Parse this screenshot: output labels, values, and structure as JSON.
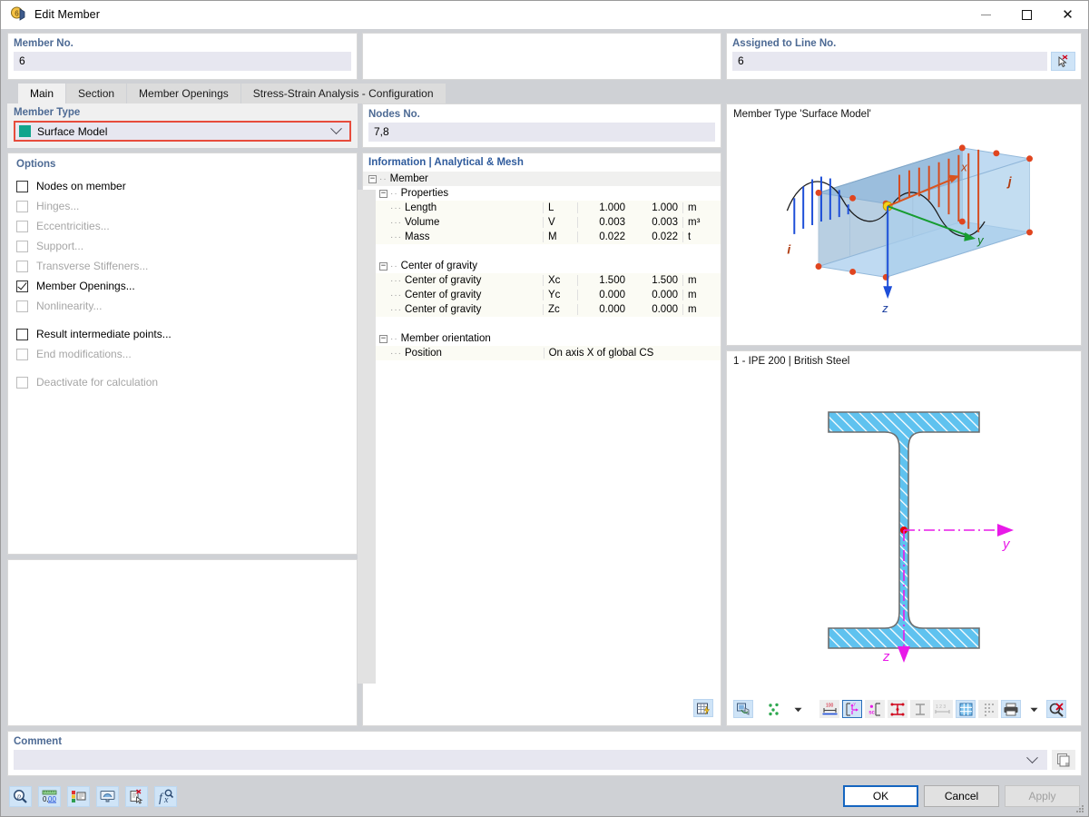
{
  "window": {
    "title": "Edit Member",
    "icon": "member-icon",
    "minimize_label": "Minimize",
    "maximize_label": "Maximize",
    "close_label": "Close"
  },
  "header": {
    "member_no_label": "Member No.",
    "member_no_value": "6",
    "assigned_label": "Assigned to Line No.",
    "assigned_value": "6",
    "pick_icon": "pick-line-icon"
  },
  "tabs": [
    {
      "label": "Main",
      "active": true
    },
    {
      "label": "Section",
      "active": false
    },
    {
      "label": "Member Openings",
      "active": false
    },
    {
      "label": "Stress-Strain Analysis - Configuration",
      "active": false
    }
  ],
  "member_type": {
    "group_label": "Member Type",
    "value": "Surface Model",
    "swatch_color": "#12a58c",
    "highlight_color": "#e74c3c"
  },
  "options": {
    "group_label": "Options",
    "items": [
      {
        "label": "Nodes on member",
        "checked": false,
        "enabled": true,
        "gap_after": false
      },
      {
        "label": "Hinges...",
        "checked": false,
        "enabled": false,
        "gap_after": false
      },
      {
        "label": "Eccentricities...",
        "checked": false,
        "enabled": false,
        "gap_after": false
      },
      {
        "label": "Support...",
        "checked": false,
        "enabled": false,
        "gap_after": false
      },
      {
        "label": "Transverse Stiffeners...",
        "checked": false,
        "enabled": false,
        "gap_after": false
      },
      {
        "label": "Member Openings...",
        "checked": true,
        "enabled": true,
        "gap_after": false
      },
      {
        "label": "Nonlinearity...",
        "checked": false,
        "enabled": false,
        "gap_after": true
      },
      {
        "label": "Result intermediate points...",
        "checked": false,
        "enabled": true,
        "gap_after": false
      },
      {
        "label": "End modifications...",
        "checked": false,
        "enabled": false,
        "gap_after": true
      },
      {
        "label": "Deactivate for calculation",
        "checked": false,
        "enabled": false,
        "gap_after": false
      }
    ]
  },
  "nodes": {
    "group_label": "Nodes No.",
    "value": "7,8"
  },
  "info": {
    "title": "Information | Analytical & Mesh",
    "root": "Member",
    "groups": [
      {
        "name": "Properties",
        "rows": [
          {
            "name": "Length",
            "symbol": "L",
            "v1": "1.000",
            "v2": "1.000",
            "unit": "m"
          },
          {
            "name": "Volume",
            "symbol": "V",
            "v1": "0.003",
            "v2": "0.003",
            "unit": "m³"
          },
          {
            "name": "Mass",
            "symbol": "M",
            "v1": "0.022",
            "v2": "0.022",
            "unit": "t"
          }
        ]
      },
      {
        "name": "Center of gravity",
        "rows": [
          {
            "name": "Center of gravity",
            "symbol": "Xc",
            "v1": "1.500",
            "v2": "1.500",
            "unit": "m"
          },
          {
            "name": "Center of gravity",
            "symbol": "Yc",
            "v1": "0.000",
            "v2": "0.000",
            "unit": "m"
          },
          {
            "name": "Center of gravity",
            "symbol": "Zc",
            "v1": "0.000",
            "v2": "0.000",
            "unit": "m"
          }
        ]
      },
      {
        "name": "Member orientation",
        "rows": [
          {
            "name": "Position",
            "symbol": "",
            "wide": "On axis X of global CS"
          }
        ]
      }
    ],
    "footer_icon": "table-export-icon"
  },
  "preview": {
    "title": "Member Type 'Surface Model'",
    "labels": {
      "node_i": "i",
      "node_j": "j",
      "axis_x": "x",
      "axis_y": "y",
      "axis_z": "z"
    }
  },
  "section": {
    "title": "1 - IPE 200 | British Steel",
    "axis_y": "y",
    "axis_z": "z",
    "toolbar": [
      {
        "name": "render-mode-icon",
        "state": "normal"
      },
      {
        "name": "point-display-icon",
        "state": "normal"
      },
      {
        "name": "dropdown-arrow-icon",
        "state": "normal"
      },
      {
        "name": "dimensions-icon",
        "state": "plain"
      },
      {
        "name": "local-axes-icon",
        "state": "selected"
      },
      {
        "name": "shear-center-icon",
        "state": "plain"
      },
      {
        "name": "stress-points-icon",
        "state": "plain"
      },
      {
        "name": "section-outline-icon",
        "state": "plain"
      },
      {
        "name": "numbering-icon",
        "state": "plain"
      },
      {
        "name": "grid-icon",
        "state": "normal"
      },
      {
        "name": "mesh-points-icon",
        "state": "plain"
      },
      {
        "name": "print-icon",
        "state": "normal"
      },
      {
        "name": "print-dropdown-icon",
        "state": "normal"
      },
      {
        "name": "reset-zoom-icon",
        "state": "normal"
      }
    ]
  },
  "comment": {
    "group_label": "Comment",
    "value": "",
    "placeholder": "",
    "copy_icon": "copy-icon"
  },
  "footer": {
    "tools": [
      {
        "name": "info-magnifier-icon"
      },
      {
        "name": "units-decimal-icon"
      },
      {
        "name": "display-properties-icon"
      },
      {
        "name": "view-settings-icon"
      },
      {
        "name": "reset-icon"
      },
      {
        "name": "formula-icon"
      }
    ],
    "ok_label": "OK",
    "cancel_label": "Cancel",
    "apply_label": "Apply"
  }
}
